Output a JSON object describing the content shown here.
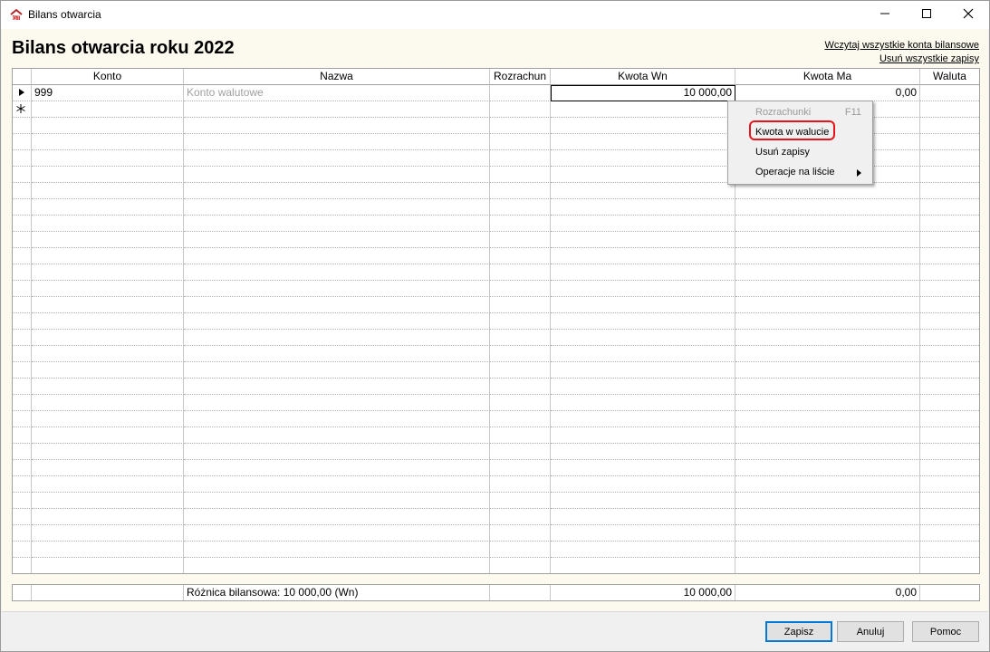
{
  "window": {
    "title": "Bilans otwarcia",
    "minimize_icon": "minimize-icon",
    "maximize_icon": "maximize-icon",
    "close_icon": "close-icon"
  },
  "header": {
    "title": "Bilans otwarcia roku 2022",
    "link_load_all": "Wczytaj wszystkie konta bilansowe",
    "link_delete_all": "Usuń wszystkie zapisy"
  },
  "grid": {
    "columns": [
      "Konto",
      "Nazwa",
      "Rozrachun",
      "Kwota Wn",
      "Kwota Ma",
      "Waluta"
    ],
    "rows": [
      {
        "indicator": "current-row-arrow-icon",
        "konto": "999",
        "nazwa": "Konto walutowe",
        "rozrachun": "",
        "kwota_wn": "10 000,00",
        "kwota_ma": "0,00",
        "waluta": ""
      }
    ],
    "new_row_indicator": "new-row-asterisk-icon"
  },
  "summary": {
    "label": "Różnica bilansowa: 10 000,00 (Wn)",
    "kwota_wn": "10 000,00",
    "kwota_ma": "0,00"
  },
  "context_menu": {
    "items": [
      {
        "label": "Rozrachunki",
        "shortcut": "F11",
        "disabled": true
      },
      {
        "label": "Kwota w walucie",
        "highlighted": true
      },
      {
        "label": "Usuń zapisy"
      },
      {
        "label": "Operacje na liście",
        "submenu": true
      }
    ],
    "highlight_color": "#e8141c"
  },
  "buttons": {
    "save": "Zapisz",
    "cancel": "Anuluj",
    "help": "Pomoc"
  },
  "colors": {
    "content_bg": "#fcf9ef",
    "default_button_border": "#0078d7"
  }
}
